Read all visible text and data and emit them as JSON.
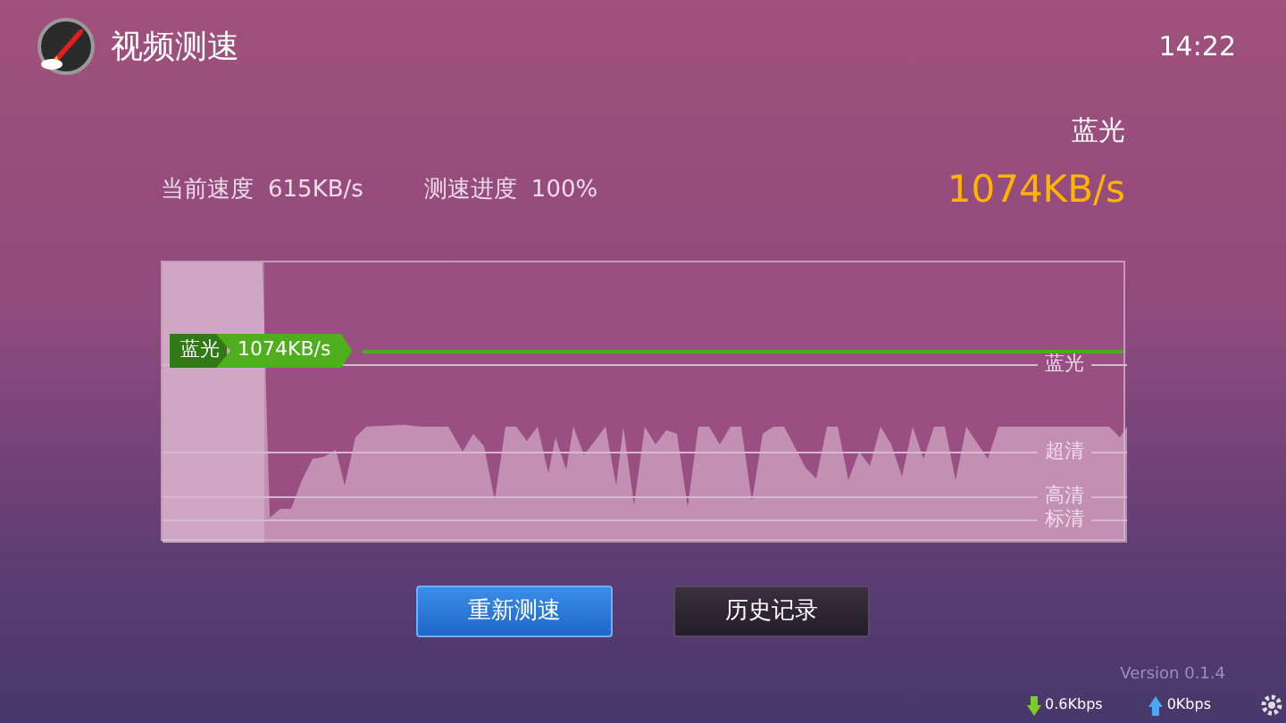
{
  "header": {
    "title": "视频测速",
    "time": "14:22"
  },
  "result": {
    "quality": "蓝光",
    "speed": "1074KB/s"
  },
  "stats": [
    {
      "label": "当前速度",
      "value": "615KB/s"
    },
    {
      "label": "测速进度",
      "value": "100%"
    }
  ],
  "graph": {
    "badge": {
      "quality": "蓝光",
      "speed": "1074KB/s"
    },
    "thresholds": [
      "蓝光",
      "超清",
      "高清",
      "标清"
    ]
  },
  "buttons": [
    {
      "label": "重新测速",
      "selected": true
    },
    {
      "label": "历史记录",
      "selected": false
    }
  ],
  "footer": {
    "version": "Version 0.1.4",
    "download": "0.6Kbps",
    "upload": "0Kbps"
  }
}
